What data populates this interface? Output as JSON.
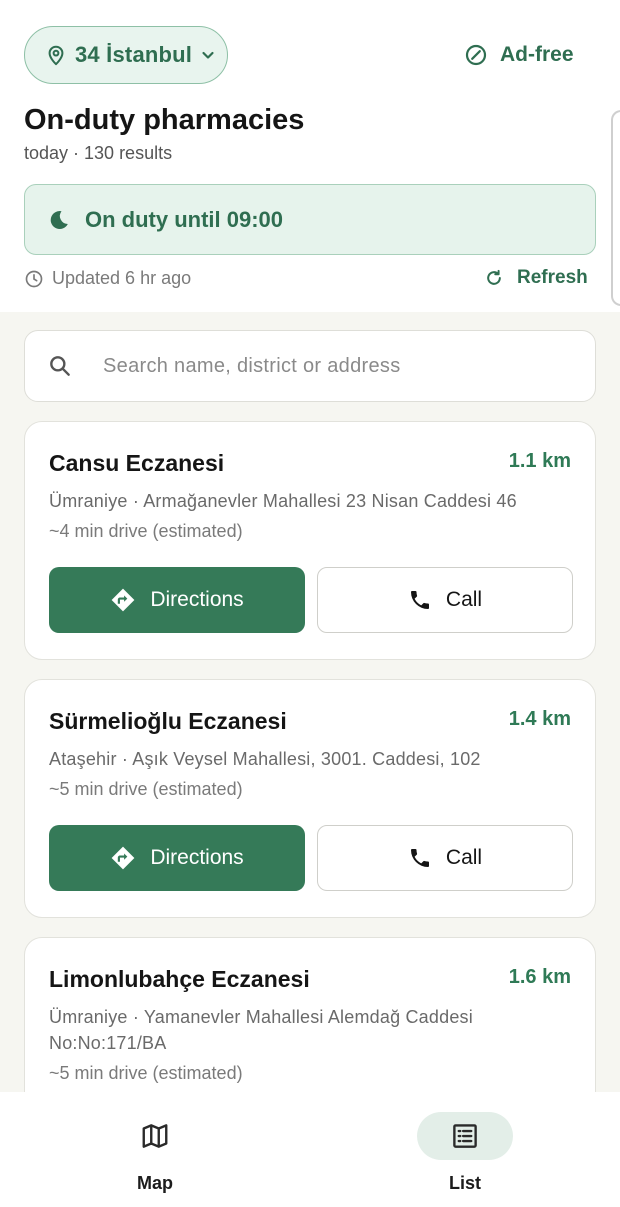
{
  "header": {
    "city_label": "34 İstanbul",
    "adfree_label": "Ad-free",
    "title": "On-duty pharmacies",
    "subtitle": "today · 130 results"
  },
  "duty_banner": {
    "label": "On duty until 09:00"
  },
  "status": {
    "updated": "Updated 6 hr ago",
    "refresh_label": "Refresh"
  },
  "search": {
    "placeholder": "Search name, district or address",
    "value": ""
  },
  "pharmacies": [
    {
      "name": "Cansu Eczanesi",
      "distance": "1.1 km",
      "address": "Ümraniye · Armağanevler Mahallesi 23 Nisan Caddesi 46",
      "eta": "~4 min drive (estimated)",
      "directions_label": "Directions",
      "call_label": "Call"
    },
    {
      "name": "Sürmelioğlu Eczanesi",
      "distance": "1.4 km",
      "address": "Ataşehir · Aşık Veysel Mahallesi, 3001. Caddesi, 102",
      "eta": "~5 min drive (estimated)",
      "directions_label": "Directions",
      "call_label": "Call"
    },
    {
      "name": "Limonlubahçe Eczanesi",
      "distance": "1.6 km",
      "address": "Ümraniye · Yamanevler Mahallesi Alemdağ Caddesi No:No:171/BA",
      "eta": "~5 min drive (estimated)"
    }
  ],
  "nav": {
    "items": [
      {
        "label": "Map",
        "icon": "map-icon",
        "active": false
      },
      {
        "label": "List",
        "icon": "list-icon",
        "active": true
      }
    ]
  },
  "colors": {
    "accent": "#357a58",
    "accent_text": "#2f6e51",
    "chip_bg": "#e8f4ee",
    "background": "#f6f6f1"
  }
}
